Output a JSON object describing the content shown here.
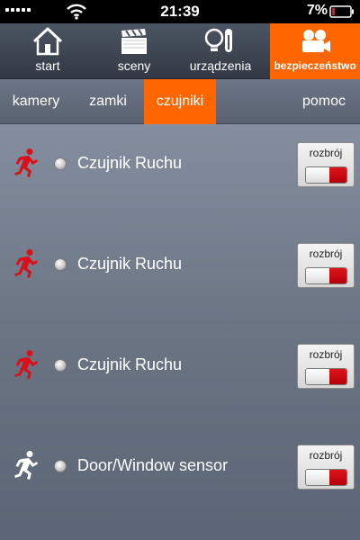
{
  "status_bar": {
    "time": "21:39",
    "battery_percent": "7%",
    "icons": [
      "signal-icon",
      "wifi-icon",
      "battery-icon"
    ]
  },
  "top_nav": {
    "items": [
      {
        "label": "start",
        "icon": "house-icon",
        "active": false
      },
      {
        "label": "sceny",
        "icon": "clapperboard-icon",
        "active": false
      },
      {
        "label": "urządzenia",
        "icon": "bulb-thermometer-icon",
        "active": false
      },
      {
        "label": "bezpieczeństwo",
        "icon": "camera-icon",
        "active": true
      }
    ]
  },
  "sub_nav": {
    "tabs": [
      {
        "label": "kamery",
        "active": false
      },
      {
        "label": "zamki",
        "active": false
      },
      {
        "label": "czujniki",
        "active": true
      },
      {
        "label": "pomoc",
        "active": false
      }
    ]
  },
  "sensors": [
    {
      "name": "Czujnik Ruchu",
      "icon": "motion-runner-red-icon",
      "arm_label": "rozbrój"
    },
    {
      "name": "Czujnik Ruchu",
      "icon": "motion-runner-red-icon",
      "arm_label": "rozbrój"
    },
    {
      "name": "Czujnik Ruchu",
      "icon": "motion-runner-red-icon",
      "arm_label": "rozbrój"
    },
    {
      "name": "Door/Window sensor",
      "icon": "motion-runner-white-icon",
      "arm_label": "rozbrój"
    }
  ],
  "colors": {
    "accent": "#ff6600",
    "runner_red": "#d9111a",
    "runner_white": "#ffffff",
    "switch_on": "#d0111a"
  }
}
